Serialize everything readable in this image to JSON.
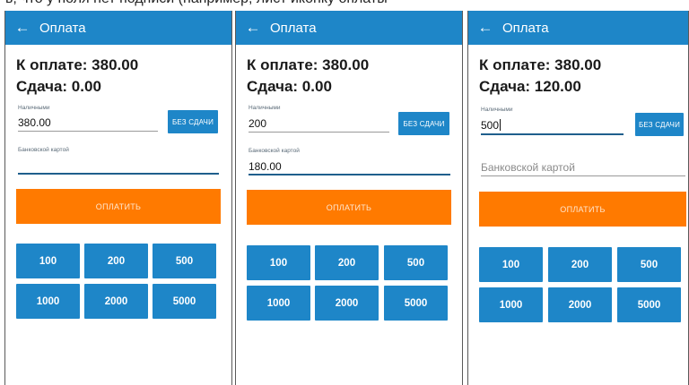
{
  "top_cutoff_text": "ь, что у поля нет подписи (например, лист иконку оплаты",
  "screens": [
    {
      "title": "Оплата",
      "amount_due": "К оплате: 380.00",
      "change": "Сдача: 0.00",
      "cash_label": "Наличными",
      "cash_value": "380.00",
      "card_label": "Банковской картой",
      "card_value": "",
      "no_change_label": "БЕЗ СДАЧИ",
      "pay_label": "ОПЛАТИТЬ",
      "quick_amounts": [
        "100",
        "200",
        "500",
        "1000",
        "2000",
        "5000"
      ]
    },
    {
      "title": "Оплата",
      "amount_due": "К оплате: 380.00",
      "change": "Сдача: 0.00",
      "cash_label": "Наличными",
      "cash_value": "200",
      "card_label": "Банковской картой",
      "card_value": "180.00",
      "no_change_label": "БЕЗ СДАЧИ",
      "pay_label": "ОПЛАТИТЬ",
      "quick_amounts": [
        "100",
        "200",
        "500",
        "1000",
        "2000",
        "5000"
      ]
    },
    {
      "title": "Оплата",
      "amount_due": "К оплате: 380.00",
      "change": "Сдача: 120.00",
      "cash_label": "Наличными",
      "cash_value": "500",
      "card_placeholder": "Банковской картой",
      "no_change_label": "БЕЗ СДАЧИ",
      "pay_label": "ОПЛАТИТЬ",
      "quick_amounts": [
        "100",
        "200",
        "500",
        "1000",
        "2000",
        "5000"
      ]
    }
  ],
  "colors": {
    "appbar": "#1e86c8",
    "pay_button": "#ff7a00",
    "quick_button": "#1e86c8",
    "active_underline": "#1f5f8c"
  },
  "icons": {
    "back": "arrow-left-icon"
  }
}
